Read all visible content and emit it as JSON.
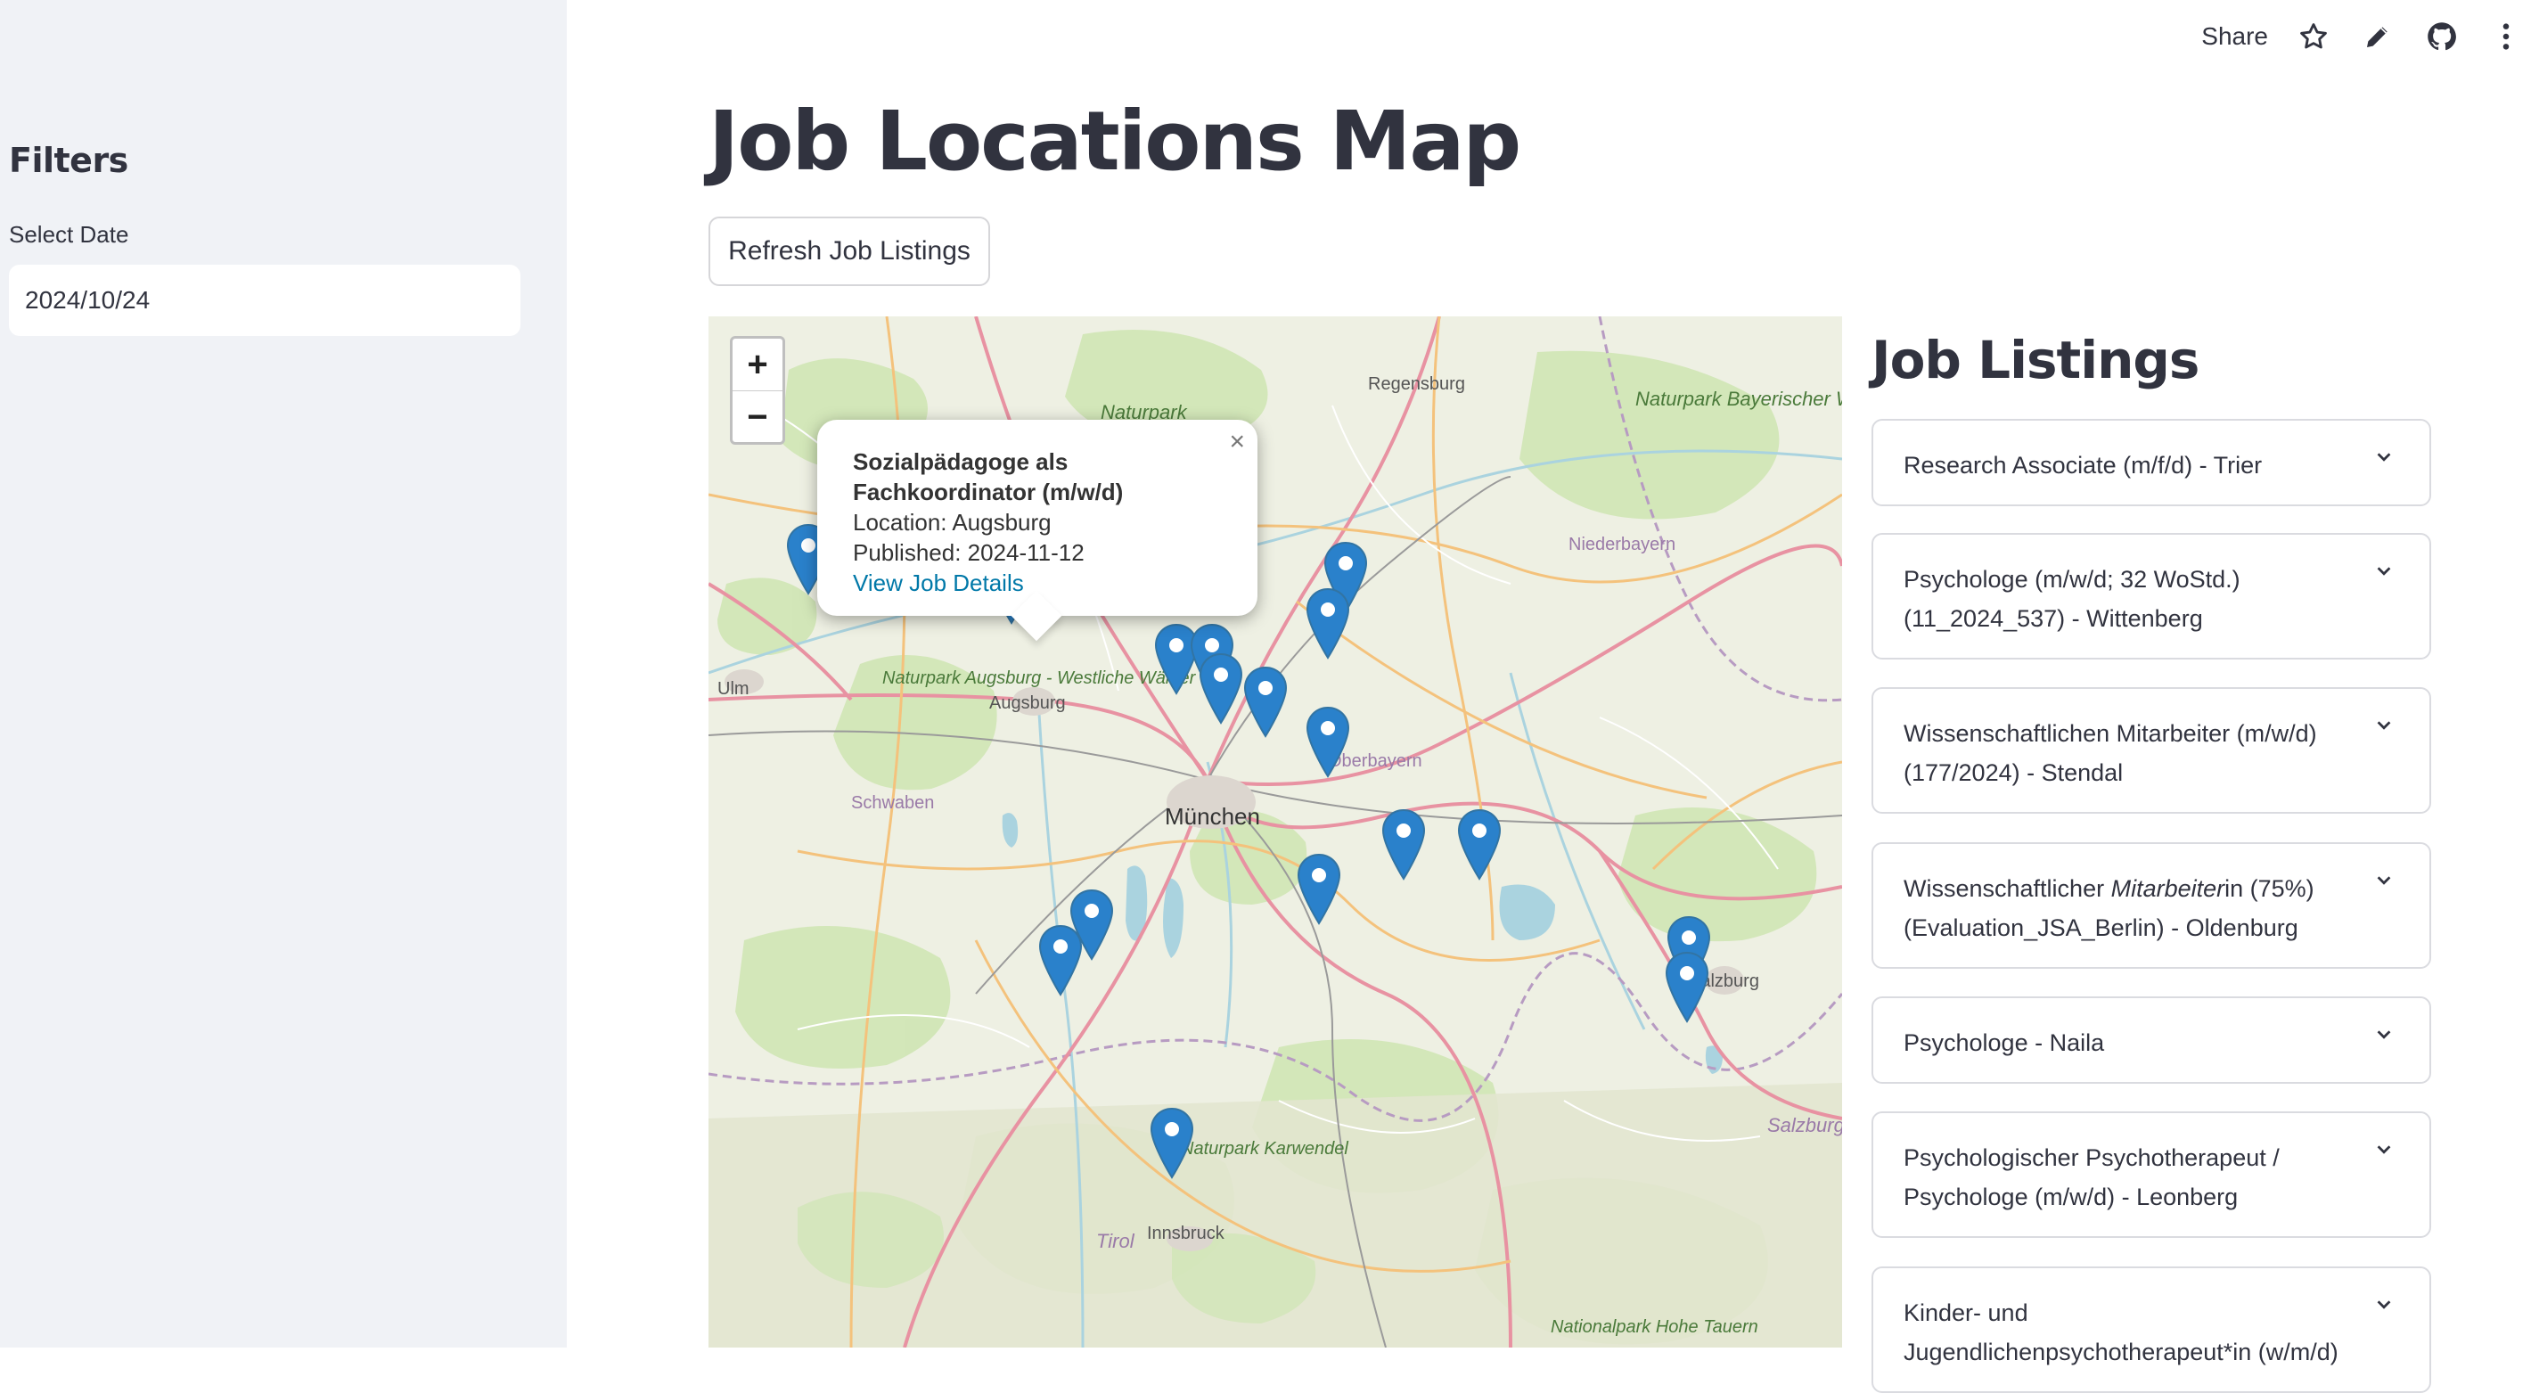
{
  "sidebar": {
    "heading": "Filters",
    "date_label": "Select Date",
    "date_value": "2024/10/24"
  },
  "toolbar": {
    "share_label": "Share",
    "icons": [
      "star-icon",
      "pencil-icon",
      "github-icon",
      "more-vert-icon"
    ]
  },
  "main": {
    "title": "Job Locations Map",
    "refresh_label": "Refresh Job Listings"
  },
  "map": {
    "zoom_in": "+",
    "zoom_out": "−",
    "place_labels": [
      "Regensburg",
      "Naturpark",
      "Naturpark Bayerischer Wald",
      "Niederbayern",
      "Ulm",
      "Naturpark Augsburg - Westliche Wälder",
      "Augsburg",
      "Schwaben",
      "München",
      "Oberbayern",
      "Salzburg",
      "Salzburg",
      "Naturpark Karwendel",
      "Tirol",
      "Innsbruck",
      "Nationalpark Hohe Tauern"
    ],
    "popup": {
      "title_line1": "Sozialpädagoge als",
      "title_line2": "Fachkoordinator (m/w/d)",
      "location": "Location: Augsburg",
      "published": "Published: 2024-11-12",
      "link": "View Job Details",
      "close": "×"
    },
    "marker_color": "#2a81cb"
  },
  "listings": {
    "title": "Job Listings",
    "items": [
      {
        "line1": "Research Associate (m/f/d) - Trier",
        "line2": ""
      },
      {
        "line1": "Psychologe (m/w/d; 32 WoStd.)",
        "line2": "(11_2024_537) - Wittenberg"
      },
      {
        "line1": "Wissenschaftlichen Mitarbeiter (m/w/d)",
        "line2": "(177/2024) - Stendal"
      },
      {
        "line1a": "Wissenschaftlicher ",
        "line1b": "Mitarbeiter",
        "line1c": "in (75%)",
        "line2": "(Evaluation_JSA_Berlin) - Oldenburg"
      },
      {
        "line1": "Psychologe - Naila",
        "line2": ""
      },
      {
        "line1": "Psychologischer Psychotherapeut /",
        "line2": "Psychologe (m/w/d) - Leonberg"
      },
      {
        "line1": "Kinder- und",
        "line2": "Jugendlichenpsychotherapeut*in (w/m/d)"
      }
    ]
  }
}
